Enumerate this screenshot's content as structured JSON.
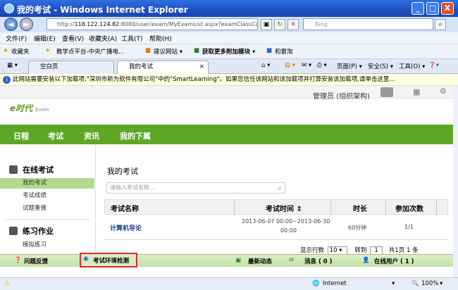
{
  "window": {
    "title": "我的考试 - Windows Internet Explorer",
    "min": "_",
    "max": "□",
    "close": "X"
  },
  "address": {
    "url_prefix": "http://",
    "url_host": "118.122.124.82",
    "url_rest": ":8080/user/exam/MyExamList.aspx?examClassCode=e",
    "search_placeholder": "Bing",
    "back": "◄",
    "fwd": "►"
  },
  "menu": [
    "文件(F)",
    "编辑(E)",
    "查看(V)",
    "收藏夹(A)",
    "工具(T)",
    "帮助(H)"
  ],
  "favbar": {
    "favorites": "收藏夹",
    "item1": "教学点平台-中央广播电...",
    "item2": "建议网站 ▾",
    "item3": "获取更多附加模块 ▾",
    "item4": "和雷淘"
  },
  "tabs": [
    {
      "label": "空白页"
    },
    {
      "label": "我的考试",
      "close": "×"
    }
  ],
  "commands": {
    "page": "页面(P) ▾",
    "safety": "安全(S) ▾",
    "tools": "工具(O) ▾"
  },
  "infobar": {
    "text": "此网站需要安装以下加载项:\"深圳市新为软件有限公司\"中的\"SmartLearning\"。如果您信任该网站和该加载项并打算安装该加载项,请单击这里..."
  },
  "header": {
    "logo": "e时代",
    "logo_sub": "Exam",
    "user": "管理员 (组织架构)"
  },
  "nav": [
    "日程",
    "考试",
    "资讯",
    "我的下属"
  ],
  "sidebar": {
    "section1": "在线考试",
    "items1": [
      "我的考试",
      "考试成绩",
      "试题重做"
    ],
    "section2": "练习作业",
    "items2": [
      "模拟练习"
    ]
  },
  "main": {
    "title": "我的考试",
    "search_placeholder": "请输入考试名称...",
    "search_icon": "⌕",
    "columns": [
      "考试名称",
      "考试时间 ⇕",
      "时长",
      "参加次数"
    ],
    "rows": [
      {
        "name": "计算机导论",
        "time_line1": "2013-06-07 00:00~2013-06-30",
        "time_line2": "00:00",
        "duration": "60分钟",
        "attempts": "1/1"
      }
    ],
    "pager": {
      "rows_label": "显示行数",
      "rows_value": "10",
      "goto_label": "转到",
      "goto_value": "1",
      "total": "共1页 1 条"
    }
  },
  "bottombar": {
    "feedback": "问题反馈",
    "env_check": "考试环境检测",
    "news": "最新动态",
    "messages": "消息 ( 0 )",
    "online": "在线用户 ( 1 )"
  },
  "statusbar": {
    "zone": "Internet",
    "zoom": "100%"
  }
}
